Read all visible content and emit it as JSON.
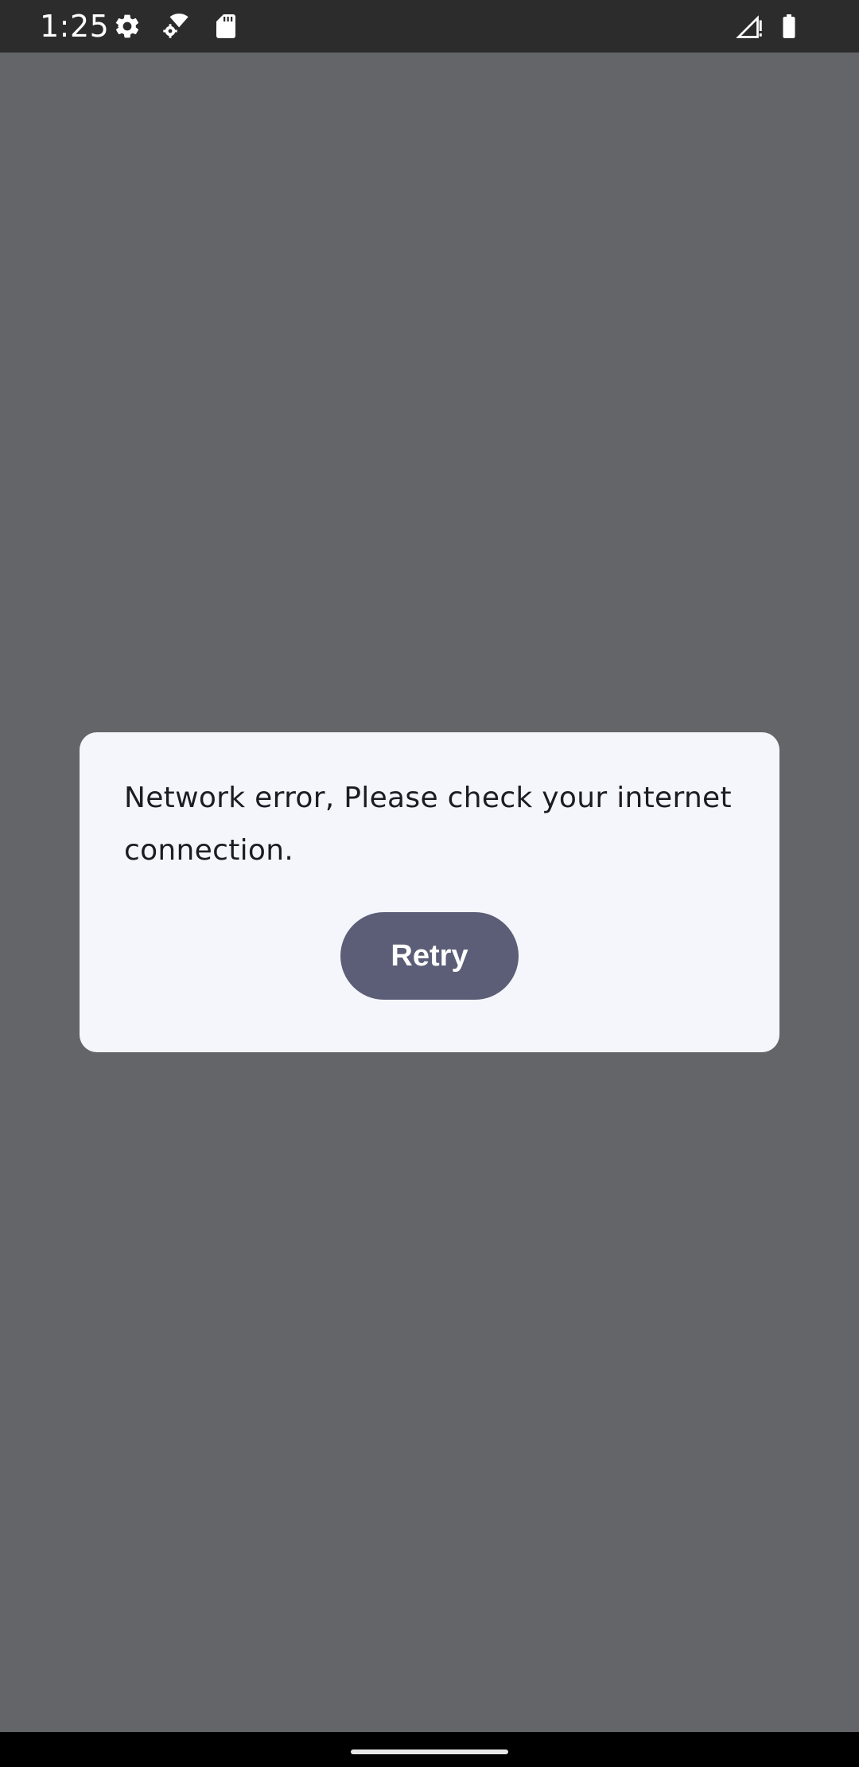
{
  "status_bar": {
    "time": "1:25",
    "icons": [
      "settings-gear-icon",
      "wifi-settings-icon",
      "sd-card-icon",
      "signal-no-service-icon",
      "battery-icon"
    ]
  },
  "dialog": {
    "message": "Network error, Please check your internet connection.",
    "retry_label": "Retry"
  },
  "colors": {
    "scrim": "#646568",
    "dialog_background": "#f5f6fc",
    "button_background": "#5b5e76",
    "status_bar": "#2c2c2c"
  }
}
